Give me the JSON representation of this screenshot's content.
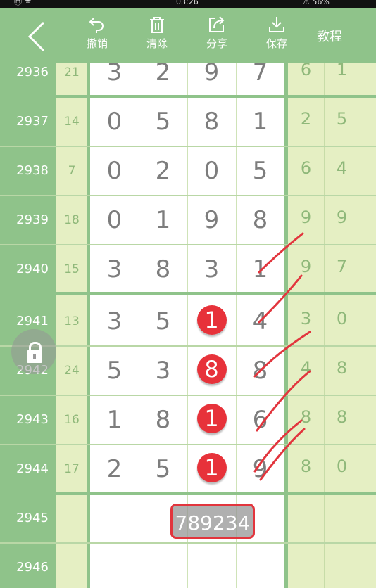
{
  "status": {
    "left": "ⓜ ᯤ",
    "time": "03:26",
    "battery": "⚠ 56%"
  },
  "toolbar": {
    "undo_label": "撤销",
    "clear_label": "清除",
    "share_label": "分享",
    "save_label": "保存",
    "tutorial_label": "教程"
  },
  "rows": [
    {
      "id": "2936",
      "sum": "21",
      "digits": [
        "3",
        "2",
        "9",
        "7"
      ],
      "right": [
        "6",
        "1"
      ]
    },
    {
      "id": "2937",
      "sum": "14",
      "digits": [
        "0",
        "5",
        "8",
        "1"
      ],
      "right": [
        "2",
        "5"
      ]
    },
    {
      "id": "2938",
      "sum": "7",
      "digits": [
        "0",
        "2",
        "0",
        "5"
      ],
      "right": [
        "6",
        "4"
      ]
    },
    {
      "id": "2939",
      "sum": "18",
      "digits": [
        "0",
        "1",
        "9",
        "8"
      ],
      "right": [
        "9",
        "9"
      ]
    },
    {
      "id": "2940",
      "sum": "15",
      "digits": [
        "3",
        "8",
        "3",
        "1"
      ],
      "right": [
        "9",
        "7"
      ]
    },
    {
      "id": "2941",
      "sum": "13",
      "digits": [
        "3",
        "5",
        "1",
        "4"
      ],
      "right": [
        "3",
        "0"
      ]
    },
    {
      "id": "2942",
      "sum": "24",
      "digits": [
        "5",
        "3",
        "8",
        "8"
      ],
      "right": [
        "4",
        "8"
      ]
    },
    {
      "id": "2943",
      "sum": "16",
      "digits": [
        "1",
        "8",
        "1",
        "6"
      ],
      "right": [
        "8",
        "8"
      ]
    },
    {
      "id": "2944",
      "sum": "17",
      "digits": [
        "2",
        "5",
        "1",
        "9"
      ],
      "right": [
        "8",
        "0"
      ]
    },
    {
      "id": "2945",
      "sum": "",
      "digits": [
        "",
        "",
        "",
        ""
      ],
      "right": [
        "",
        ""
      ]
    },
    {
      "id": "2946",
      "sum": "",
      "digits": [
        "",
        "",
        "",
        ""
      ],
      "right": [
        "",
        ""
      ]
    }
  ],
  "highlight_column": 2,
  "highlight_rows": [
    5,
    6,
    7,
    8
  ],
  "input_value": "789234",
  "colors": {
    "header": "#8fc38a",
    "ball": "#e7323a",
    "pen": "#e2353d"
  },
  "icons": [
    "back-chevron-icon",
    "undo-icon",
    "trash-icon",
    "share-icon",
    "download-icon",
    "lock-icon"
  ]
}
